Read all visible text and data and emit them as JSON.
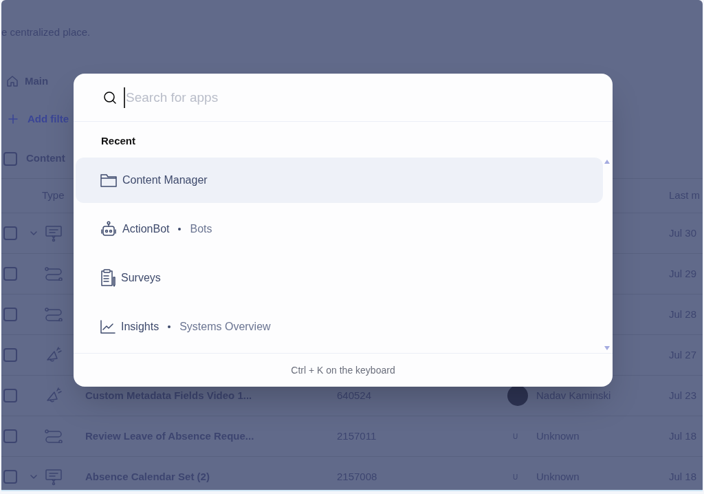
{
  "page": {
    "subtitle": "e centralized place.",
    "nav": {
      "label": "Main"
    },
    "add_filter": "Add filte",
    "content_header": {
      "label": "Content",
      "checked": false
    },
    "columns": {
      "type": "Type",
      "last_modified": "Last m"
    },
    "rows": [
      {
        "checked": false,
        "expandable": true,
        "kind": "message",
        "date": "Jul 30"
      },
      {
        "checked": false,
        "expandable": false,
        "kind": "flow",
        "date": "Jul 29"
      },
      {
        "checked": false,
        "expandable": false,
        "kind": "flow",
        "date": "Jul 28"
      },
      {
        "checked": false,
        "expandable": false,
        "kind": "announcement",
        "date": "Jul 27"
      },
      {
        "checked": false,
        "expandable": false,
        "kind": "announcement",
        "name": "Custom Metadata Fields Video 1...",
        "id": "640524",
        "owner": {
          "kind": "photo",
          "name": "Nadav Kaminski"
        },
        "date": "Jul 23"
      },
      {
        "checked": false,
        "expandable": false,
        "kind": "flow",
        "name": "Review Leave of Absence Reque...",
        "id": "2157011",
        "owner": {
          "kind": "initial",
          "initial": "U",
          "name": "Unknown"
        },
        "date": "Jul 18"
      },
      {
        "checked": false,
        "expandable": true,
        "kind": "message",
        "name": "Absence Calendar Set (2)",
        "id": "2157008",
        "owner": {
          "kind": "initial",
          "initial": "U",
          "name": "Unknown"
        },
        "date": "Jul 18"
      }
    ]
  },
  "modal": {
    "search": {
      "placeholder": "Search for apps"
    },
    "section": "Recent",
    "items": [
      {
        "kind": "folder",
        "title": "Content Manager",
        "selected": true
      },
      {
        "kind": "bot",
        "title": "ActionBot",
        "subtitle": "Bots",
        "selected": false
      },
      {
        "kind": "survey",
        "title": "Surveys",
        "selected": false
      },
      {
        "kind": "analytics",
        "title": "Insights",
        "subtitle": "Systems Overview",
        "selected": false
      }
    ],
    "footer": "Ctrl + K on the keyboard"
  }
}
